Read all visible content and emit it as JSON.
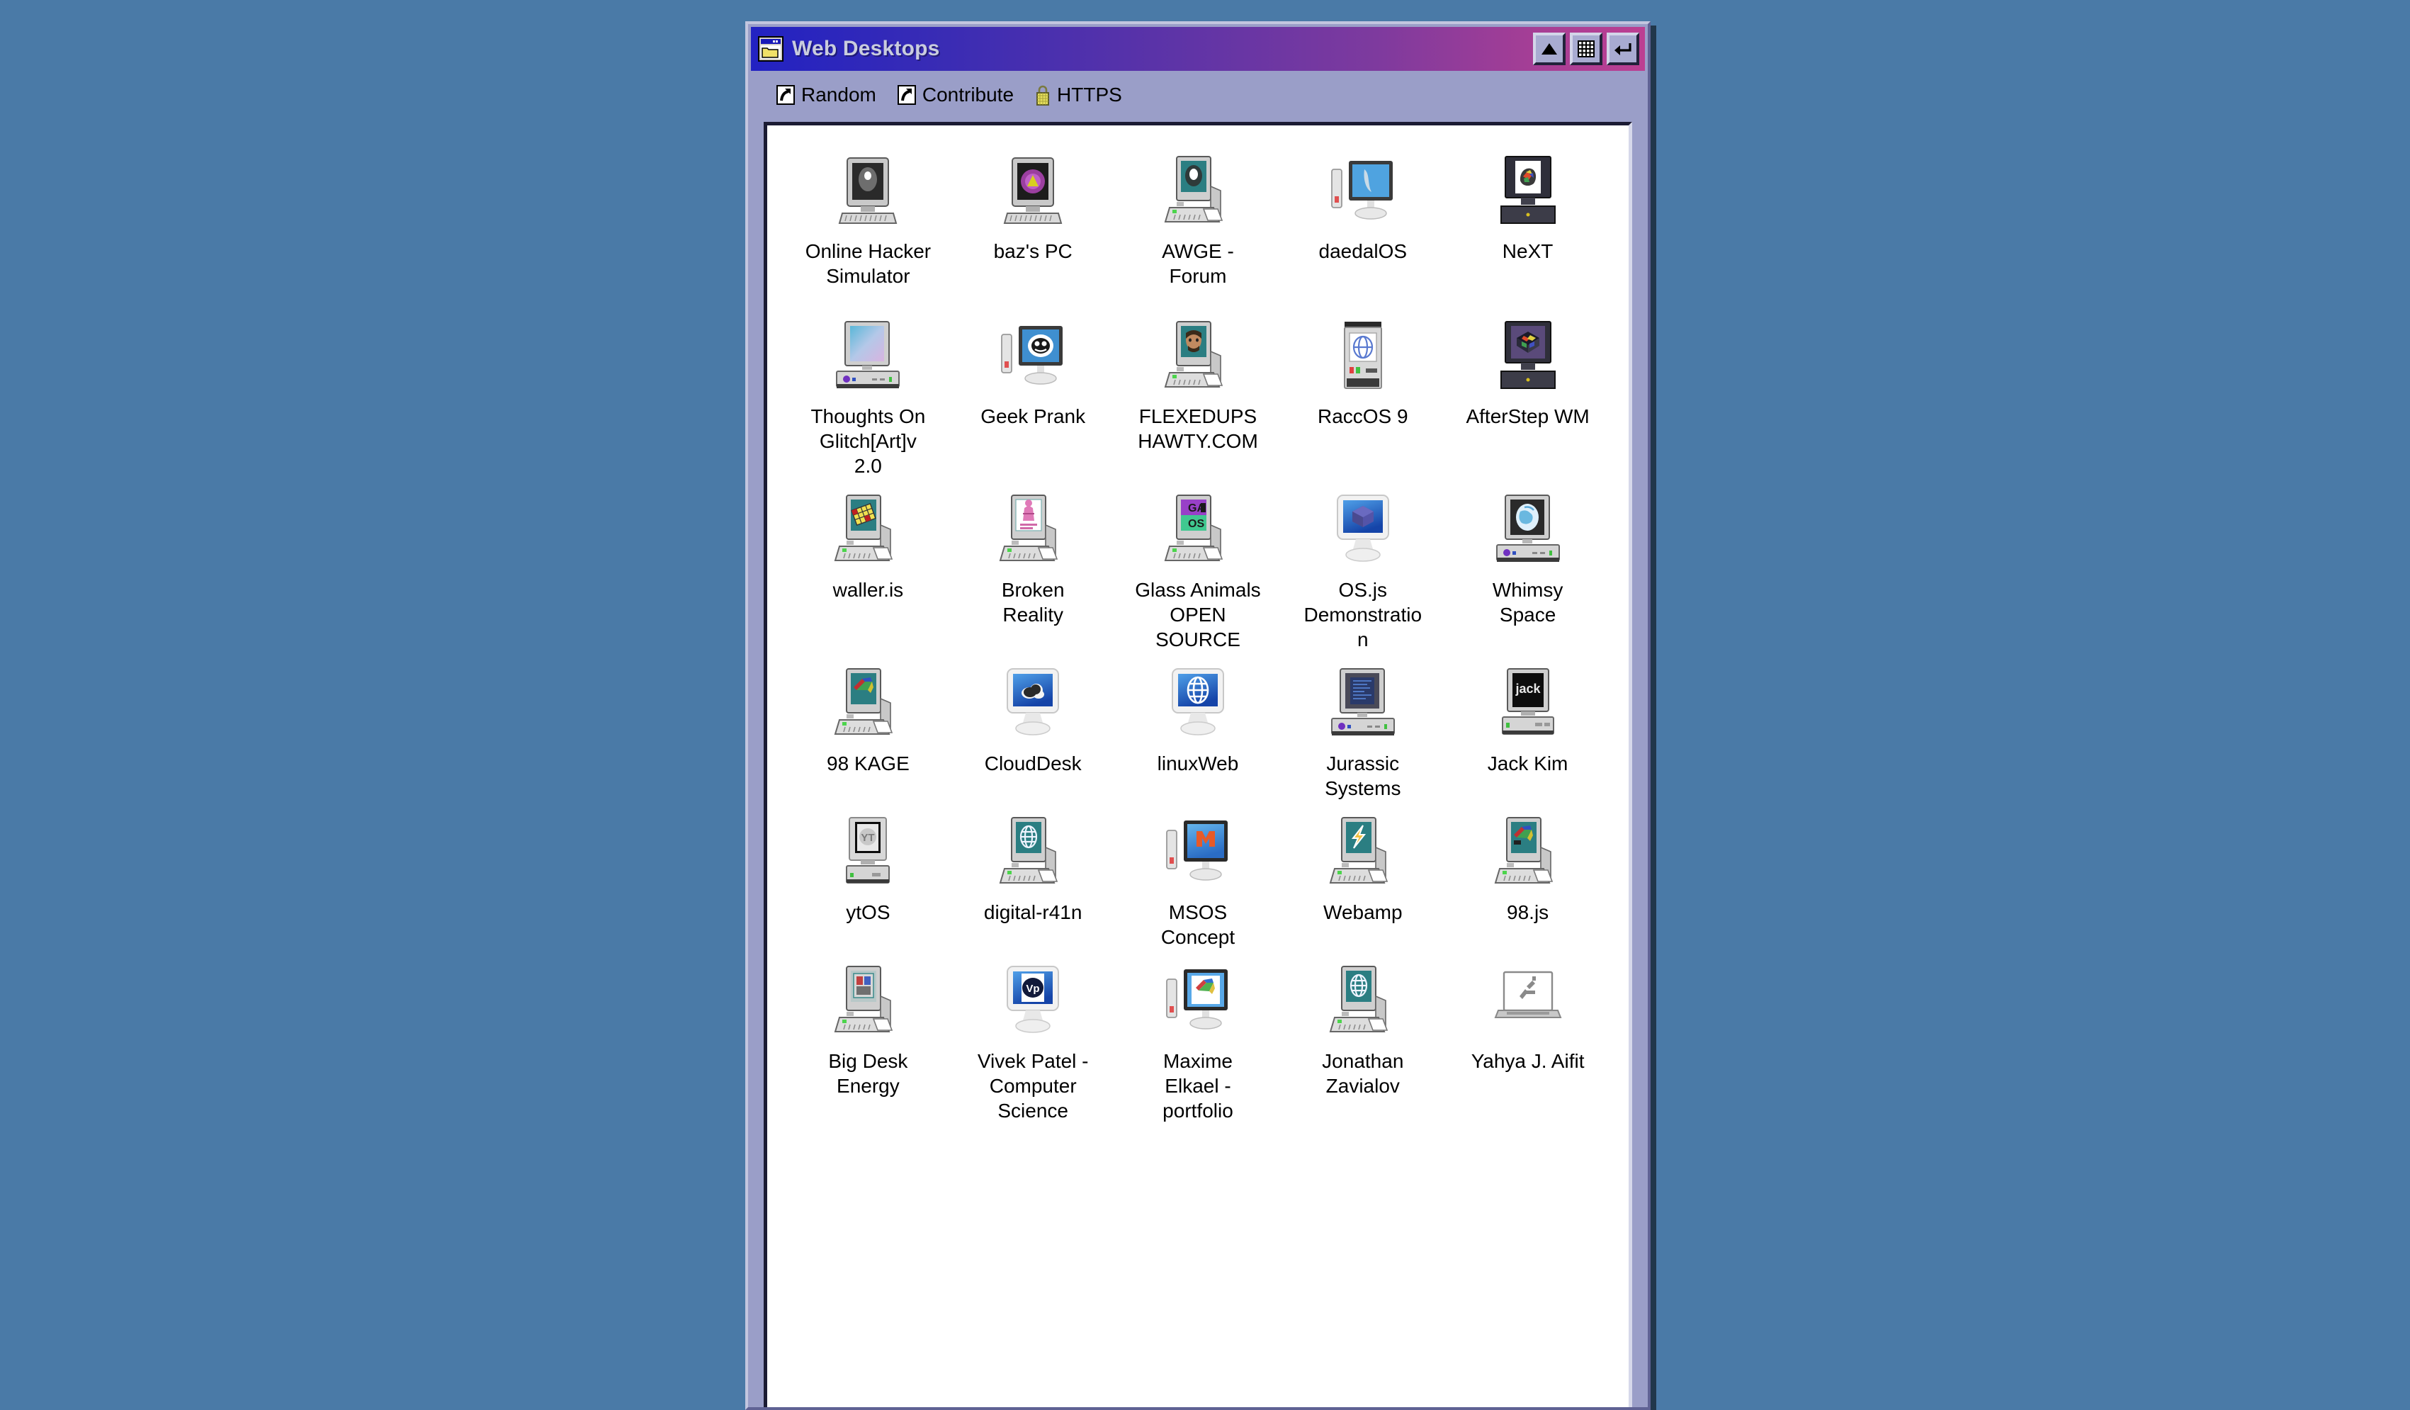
{
  "desktop": {
    "background_color": "#4a7aa7"
  },
  "window": {
    "title": "Web Desktops",
    "title_icon": "folder-window-icon",
    "titlebar_gradient_start": "#2222c2",
    "titlebar_gradient_end": "#bc3f92",
    "frame_color": "#9a9ec8",
    "buttons": [
      {
        "name": "shade-button",
        "icon": "triangle-up-icon",
        "label": ""
      },
      {
        "name": "maximize-button",
        "icon": "grid-icon",
        "label": ""
      },
      {
        "name": "close-button",
        "icon": "return-arrow-icon",
        "label": ""
      }
    ]
  },
  "toolbar": {
    "links": [
      {
        "label": "Random",
        "icon": "shortcut-arrow-icon"
      },
      {
        "label": "Contribute",
        "icon": "shortcut-arrow-icon"
      },
      {
        "label": "HTTPS",
        "icon": "padlock-icon"
      }
    ]
  },
  "grid": {
    "columns": 5,
    "items": [
      {
        "label": "Online Hacker Simulator",
        "icon": "crt-tower-pc-icon",
        "screen": "hacker-face"
      },
      {
        "label": "baz's PC",
        "icon": "crt-tower-pc-icon",
        "screen": "purple-flower"
      },
      {
        "label": "AWGE - Forum",
        "icon": "desktop-keyboard-mouse-icon",
        "screen": "teal-oval"
      },
      {
        "label": "daedalOS",
        "icon": "flat-monitor-tower-icon",
        "screen": "blue-smoke"
      },
      {
        "label": "NeXT",
        "icon": "next-cube-monitor-icon",
        "screen": "colorful-blob"
      },
      {
        "label": "Thoughts On Glitch[Art]v 2.0",
        "icon": "desktop-box-pc-icon",
        "screen": "gradient-pastel"
      },
      {
        "label": "Geek Prank",
        "icon": "flat-monitor-tower-icon",
        "screen": "bw-skull"
      },
      {
        "label": "FLEXEDUPSHAWTY.COM",
        "icon": "desktop-keyboard-mouse-icon",
        "screen": "teal-portrait"
      },
      {
        "label": "RaccOS 9",
        "icon": "mac-tower-icon",
        "screen": "blue-globe"
      },
      {
        "label": "AfterStep WM",
        "icon": "next-cube-monitor-icon",
        "screen": "purple-cube"
      },
      {
        "label": "waller.is",
        "icon": "desktop-keyboard-mouse-icon",
        "screen": "yellow-checker"
      },
      {
        "label": "Broken Reality",
        "icon": "desktop-keyboard-mouse-icon",
        "screen": "pink-figure"
      },
      {
        "label": "Glass Animals OPEN SOURCE",
        "icon": "desktop-keyboard-mouse-icon",
        "screen": "ga-os-text"
      },
      {
        "label": "OS.js Demonstration",
        "icon": "lcd-monitor-icon",
        "screen": "blue-cube"
      },
      {
        "label": "Whimsy Space",
        "icon": "desktop-box-pc-icon",
        "screen": "globe-oval"
      },
      {
        "label": "98 KAGE",
        "icon": "desktop-keyboard-mouse-icon",
        "screen": "windows-flag"
      },
      {
        "label": "CloudDesk",
        "icon": "lcd-monitor-icon",
        "screen": "cloud"
      },
      {
        "label": "linuxWeb",
        "icon": "lcd-monitor-icon",
        "screen": "white-globe"
      },
      {
        "label": "Jurassic Systems",
        "icon": "desktop-box-pc-icon",
        "screen": "blue-terminal"
      },
      {
        "label": "Jack Kim",
        "icon": "crt-tower-pc-icon",
        "screen": "jack-text"
      },
      {
        "label": "ytOS",
        "icon": "crt-tower-pc-icon",
        "screen": "yt-logo"
      },
      {
        "label": "digital-r41n",
        "icon": "desktop-keyboard-mouse-icon",
        "screen": "blue-globe"
      },
      {
        "label": "MSOS Concept",
        "icon": "flat-monitor-tower-icon",
        "screen": "orange-m"
      },
      {
        "label": "Webamp",
        "icon": "desktop-keyboard-mouse-icon",
        "screen": "lightning-bolt"
      },
      {
        "label": "98.js",
        "icon": "desktop-keyboard-mouse-icon",
        "screen": "windows-flag"
      },
      {
        "label": "Big Desk Energy",
        "icon": "desktop-keyboard-mouse-icon",
        "screen": "small-picture"
      },
      {
        "label": "Vivek Patel - Computer Science",
        "icon": "lcd-monitor-icon",
        "screen": "vp-badge"
      },
      {
        "label": "Maxime Elkael - portfolio",
        "icon": "flat-monitor-tower-icon",
        "screen": "windows-xp-flag"
      },
      {
        "label": "Jonathan Zavialov",
        "icon": "desktop-keyboard-mouse-icon",
        "screen": "teal-globe"
      },
      {
        "label": "Yahya J. Aifit",
        "icon": "laptop-icon",
        "screen": "gray-squiggle"
      }
    ]
  }
}
